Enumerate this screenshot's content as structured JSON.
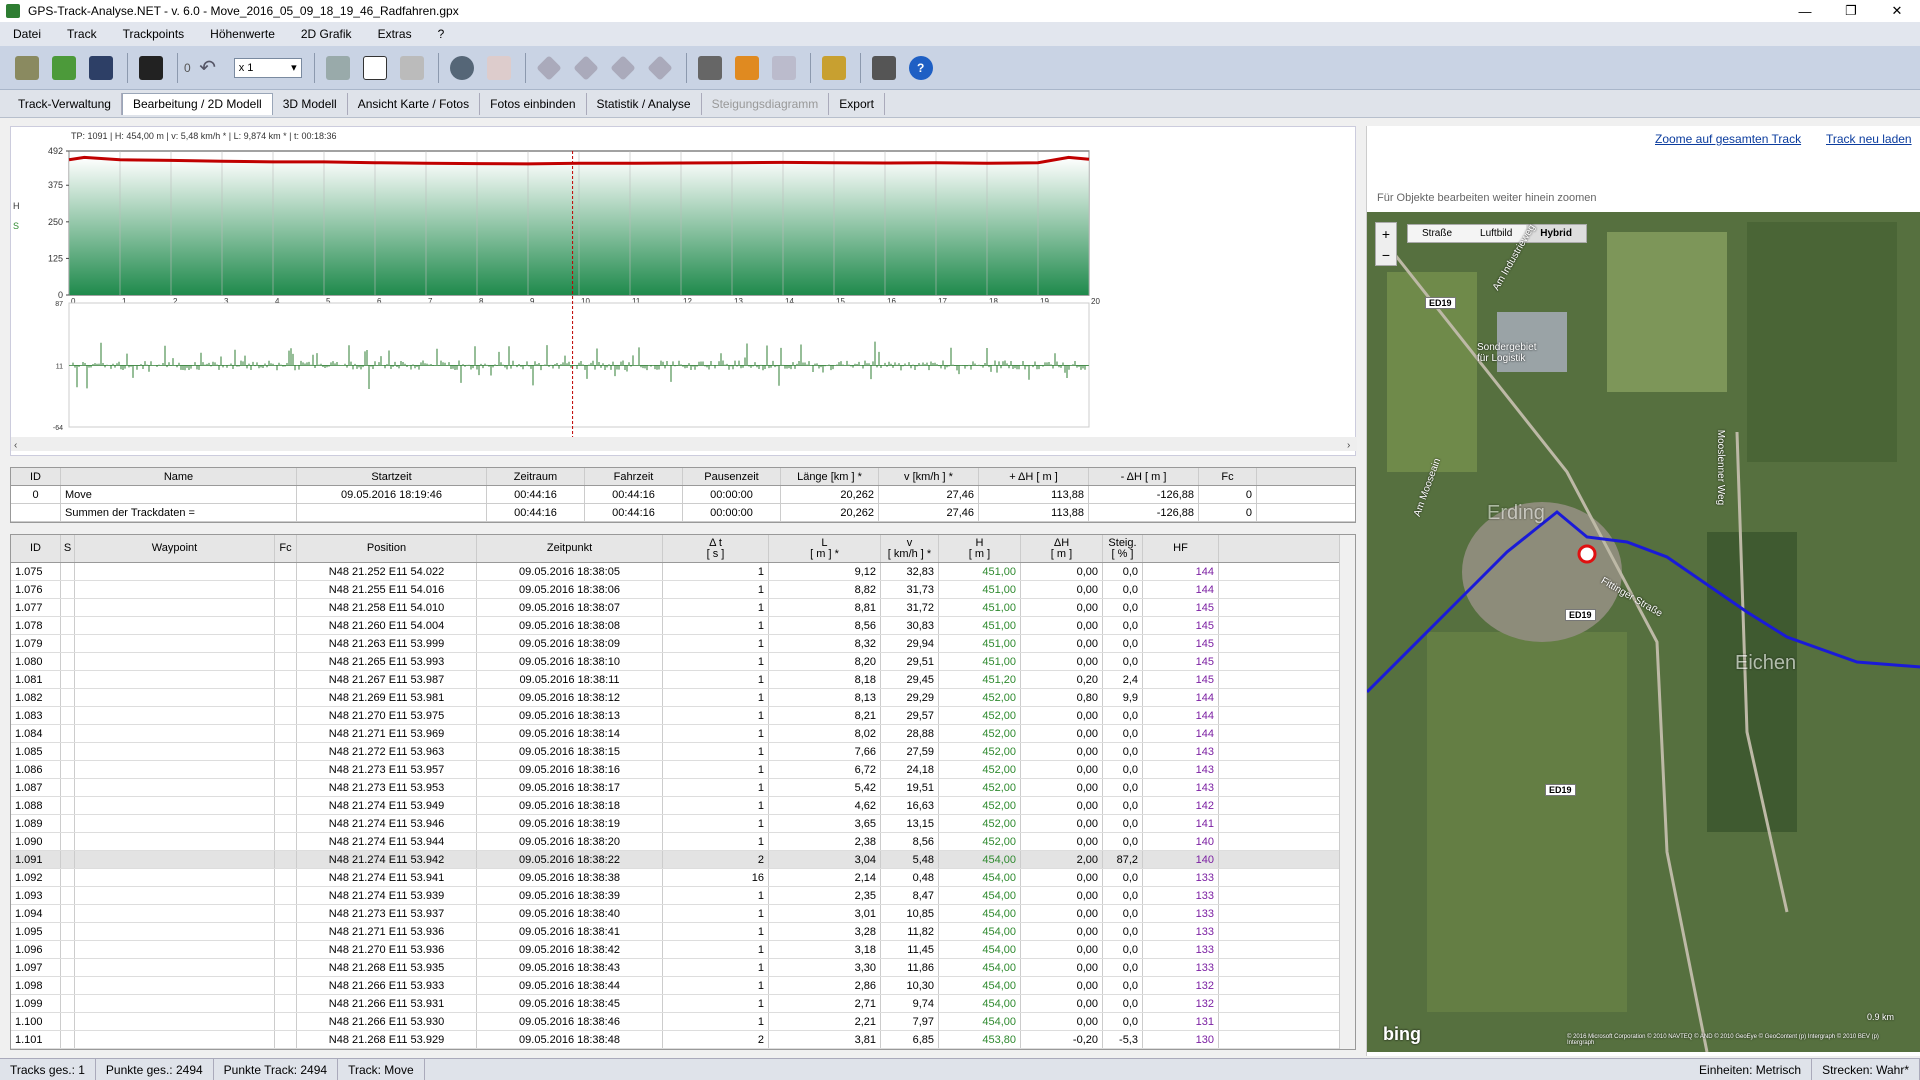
{
  "window": {
    "title": "GPS-Track-Analyse.NET  -  v. 6.0  -   Move_2016_05_09_18_19_46_Radfahren.gpx",
    "min": "—",
    "max": "❐",
    "close": "✕"
  },
  "menu": [
    "Datei",
    "Track",
    "Trackpoints",
    "Höhenwerte",
    "2D Grafik",
    "Extras",
    "?"
  ],
  "toolbar": {
    "counter": "0",
    "zoom": "x 1"
  },
  "tabs": [
    {
      "label": "Track-Verwaltung",
      "state": "normal"
    },
    {
      "label": "Bearbeitung / 2D Modell",
      "state": "active"
    },
    {
      "label": "3D Modell",
      "state": "normal"
    },
    {
      "label": "Ansicht Karte / Fotos",
      "state": "normal"
    },
    {
      "label": "Fotos einbinden",
      "state": "normal"
    },
    {
      "label": "Statistik / Analyse",
      "state": "normal"
    },
    {
      "label": "Steigungsdiagramm",
      "state": "disabled"
    },
    {
      "label": "Export",
      "state": "normal"
    }
  ],
  "chart_data": {
    "type": "area",
    "info": "TP: 1091 | H: 454,00 m | v: 5,48 km/h * | L: 9,874 km * | t: 00:18:36",
    "y_axis_letters": [
      "H",
      "S"
    ],
    "ylim": [
      0,
      492
    ],
    "yticks": [
      "492",
      "375",
      "250",
      "125",
      "0"
    ],
    "xticks": [
      "0",
      "1",
      "2",
      "3",
      "4",
      "5",
      "6",
      "7",
      "8",
      "9",
      "10",
      "11",
      "12",
      "13",
      "14",
      "15",
      "16",
      "17",
      "18",
      "19",
      "20"
    ],
    "xlim": [
      0,
      20
    ],
    "cursor_x": 9.874,
    "elevation": {
      "x": [
        0,
        0.3,
        1,
        2,
        3,
        4,
        5,
        6,
        7,
        8,
        9,
        10,
        11,
        12,
        13,
        14,
        15,
        16,
        17,
        18,
        19,
        19.6,
        20
      ],
      "y": [
        462,
        470,
        462,
        460,
        457,
        455,
        455,
        452,
        450,
        449,
        448,
        450,
        450,
        451,
        452,
        453,
        452,
        451,
        452,
        450,
        452,
        470,
        464
      ]
    },
    "slope_ylim": [
      -64,
      87
    ],
    "slope_yticks": [
      "87",
      "11",
      "-64"
    ]
  },
  "track_table": {
    "headers": [
      "ID",
      "Name",
      "Startzeit",
      "Zeitraum",
      "Fahrzeit",
      "Pausenzeit",
      "Länge  [km ] *",
      "v  [km/h ] *",
      "+ ΔH  [ m ]",
      "- ΔH  [ m ]",
      "Fc"
    ],
    "rows": [
      [
        "0",
        "Move",
        "09.05.2016 18:19:46",
        "00:44:16",
        "00:44:16",
        "00:00:00",
        "20,262",
        "27,46",
        "113,88",
        "-126,88",
        "0"
      ],
      [
        "",
        "Summen der Trackdaten =",
        "",
        "00:44:16",
        "00:44:16",
        "00:00:00",
        "20,262",
        "27,46",
        "113,88",
        "-126,88",
        "0"
      ]
    ]
  },
  "wp_table": {
    "headers": [
      "ID",
      "S",
      "Waypoint",
      "Fc",
      "Position",
      "Zeitpunkt",
      "Δ t\n[ s ]",
      "L\n[ m ] *",
      "v\n[ km/h ] *",
      "H\n[ m ]",
      "ΔH\n[ m ]",
      "Steig.\n[ % ]",
      "HF"
    ],
    "rows": [
      [
        "1.075",
        "N48 21.252 E11 54.022",
        "09.05.2016 18:38:05",
        "1",
        "9,12",
        "32,83",
        "451,00",
        "0,00",
        "0,0",
        "144"
      ],
      [
        "1.076",
        "N48 21.255 E11 54.016",
        "09.05.2016 18:38:06",
        "1",
        "8,82",
        "31,73",
        "451,00",
        "0,00",
        "0,0",
        "144"
      ],
      [
        "1.077",
        "N48 21.258 E11 54.010",
        "09.05.2016 18:38:07",
        "1",
        "8,81",
        "31,72",
        "451,00",
        "0,00",
        "0,0",
        "145"
      ],
      [
        "1.078",
        "N48 21.260 E11 54.004",
        "09.05.2016 18:38:08",
        "1",
        "8,56",
        "30,83",
        "451,00",
        "0,00",
        "0,0",
        "145"
      ],
      [
        "1.079",
        "N48 21.263 E11 53.999",
        "09.05.2016 18:38:09",
        "1",
        "8,32",
        "29,94",
        "451,00",
        "0,00",
        "0,0",
        "145"
      ],
      [
        "1.080",
        "N48 21.265 E11 53.993",
        "09.05.2016 18:38:10",
        "1",
        "8,20",
        "29,51",
        "451,00",
        "0,00",
        "0,0",
        "145"
      ],
      [
        "1.081",
        "N48 21.267 E11 53.987",
        "09.05.2016 18:38:11",
        "1",
        "8,18",
        "29,45",
        "451,20",
        "0,20",
        "2,4",
        "145"
      ],
      [
        "1.082",
        "N48 21.269 E11 53.981",
        "09.05.2016 18:38:12",
        "1",
        "8,13",
        "29,29",
        "452,00",
        "0,80",
        "9,9",
        "144"
      ],
      [
        "1.083",
        "N48 21.270 E11 53.975",
        "09.05.2016 18:38:13",
        "1",
        "8,21",
        "29,57",
        "452,00",
        "0,00",
        "0,0",
        "144"
      ],
      [
        "1.084",
        "N48 21.271 E11 53.969",
        "09.05.2016 18:38:14",
        "1",
        "8,02",
        "28,88",
        "452,00",
        "0,00",
        "0,0",
        "144"
      ],
      [
        "1.085",
        "N48 21.272 E11 53.963",
        "09.05.2016 18:38:15",
        "1",
        "7,66",
        "27,59",
        "452,00",
        "0,00",
        "0,0",
        "143"
      ],
      [
        "1.086",
        "N48 21.273 E11 53.957",
        "09.05.2016 18:38:16",
        "1",
        "6,72",
        "24,18",
        "452,00",
        "0,00",
        "0,0",
        "143"
      ],
      [
        "1.087",
        "N48 21.273 E11 53.953",
        "09.05.2016 18:38:17",
        "1",
        "5,42",
        "19,51",
        "452,00",
        "0,00",
        "0,0",
        "143"
      ],
      [
        "1.088",
        "N48 21.274 E11 53.949",
        "09.05.2016 18:38:18",
        "1",
        "4,62",
        "16,63",
        "452,00",
        "0,00",
        "0,0",
        "142"
      ],
      [
        "1.089",
        "N48 21.274 E11 53.946",
        "09.05.2016 18:38:19",
        "1",
        "3,65",
        "13,15",
        "452,00",
        "0,00",
        "0,0",
        "141"
      ],
      [
        "1.090",
        "N48 21.274 E11 53.944",
        "09.05.2016 18:38:20",
        "1",
        "2,38",
        "8,56",
        "452,00",
        "0,00",
        "0,0",
        "140"
      ],
      [
        "1.091",
        "N48 21.274 E11 53.942",
        "09.05.2016 18:38:22",
        "2",
        "3,04",
        "5,48",
        "454,00",
        "2,00",
        "87,2",
        "140"
      ],
      [
        "1.092",
        "N48 21.274 E11 53.941",
        "09.05.2016 18:38:38",
        "16",
        "2,14",
        "0,48",
        "454,00",
        "0,00",
        "0,0",
        "133"
      ],
      [
        "1.093",
        "N48 21.274 E11 53.939",
        "09.05.2016 18:38:39",
        "1",
        "2,35",
        "8,47",
        "454,00",
        "0,00",
        "0,0",
        "133"
      ],
      [
        "1.094",
        "N48 21.273 E11 53.937",
        "09.05.2016 18:38:40",
        "1",
        "3,01",
        "10,85",
        "454,00",
        "0,00",
        "0,0",
        "133"
      ],
      [
        "1.095",
        "N48 21.271 E11 53.936",
        "09.05.2016 18:38:41",
        "1",
        "3,28",
        "11,82",
        "454,00",
        "0,00",
        "0,0",
        "133"
      ],
      [
        "1.096",
        "N48 21.270 E11 53.936",
        "09.05.2016 18:38:42",
        "1",
        "3,18",
        "11,45",
        "454,00",
        "0,00",
        "0,0",
        "133"
      ],
      [
        "1.097",
        "N48 21.268 E11 53.935",
        "09.05.2016 18:38:43",
        "1",
        "3,30",
        "11,86",
        "454,00",
        "0,00",
        "0,0",
        "133"
      ],
      [
        "1.098",
        "N48 21.266 E11 53.933",
        "09.05.2016 18:38:44",
        "1",
        "2,86",
        "10,30",
        "454,00",
        "0,00",
        "0,0",
        "132"
      ],
      [
        "1.099",
        "N48 21.266 E11 53.931",
        "09.05.2016 18:38:45",
        "1",
        "2,71",
        "9,74",
        "454,00",
        "0,00",
        "0,0",
        "132"
      ],
      [
        "1.100",
        "N48 21.266 E11 53.930",
        "09.05.2016 18:38:46",
        "1",
        "2,21",
        "7,97",
        "454,00",
        "0,00",
        "0,0",
        "131"
      ],
      [
        "1.101",
        "N48 21.268 E11 53.929",
        "09.05.2016 18:38:48",
        "2",
        "3,81",
        "6,85",
        "453,80",
        "-0,20",
        "-5,3",
        "130"
      ]
    ],
    "selected_id": "1.091"
  },
  "right": {
    "zoom_all": "Zoome auf gesamten Track",
    "reload": "Track neu laden",
    "hint": "Für Objekte bearbeiten weiter hinein zoomen",
    "map_types": [
      "Straße",
      "Luftbild",
      "Hybrid"
    ],
    "map_active": "Hybrid",
    "roads": [
      "ED19",
      "ED19",
      "ED19"
    ],
    "place_labels": [
      "Sondergebiet für Logistik",
      "Am Mooseain",
      "Mooslenner Weg",
      "Am Industrieweg",
      "Fittinger Straße",
      "Erding",
      "Eichen"
    ],
    "scale": "0.9 km",
    "copyright": "© 2016 Microsoft Corporation  © 2010 NAVTEQ  © AND  © 2010 GeoEye  © GeoContent  (p) Intergraph  © 2010 BEV  (p) Intergraph",
    "bing": "bing"
  },
  "status": [
    "Tracks ges.:  1",
    "Punkte ges.:  2494",
    "Punkte Track:  2494",
    "Track:  Move",
    "Einheiten: Metrisch",
    "Strecken: Wahr*"
  ]
}
